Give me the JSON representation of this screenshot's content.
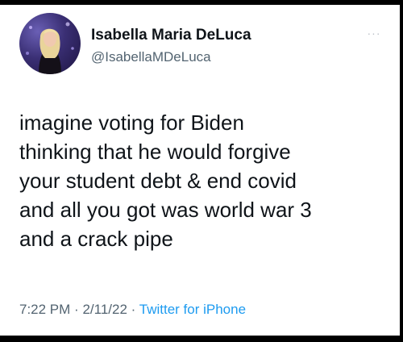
{
  "tweet": {
    "author_name": "Isabella Maria DeLuca",
    "author_handle": "@IsabellaMDeLuca",
    "more_label": "···",
    "text_lines": [
      "imagine voting for Biden",
      "thinking that he would forgive",
      "your student debt & end covid",
      "and all you got was world war 3",
      "and a crack pipe"
    ],
    "time": "7:22 PM",
    "separator": "·",
    "date": "2/11/22",
    "source": "Twitter for iPhone"
  },
  "icons": {
    "avatar": "profile-photo",
    "more": "more-options-icon"
  },
  "colors": {
    "background": "#ffffff",
    "text": "#0f1419",
    "secondary": "#536471",
    "link": "#1d9bf0",
    "frame": "#000000"
  }
}
